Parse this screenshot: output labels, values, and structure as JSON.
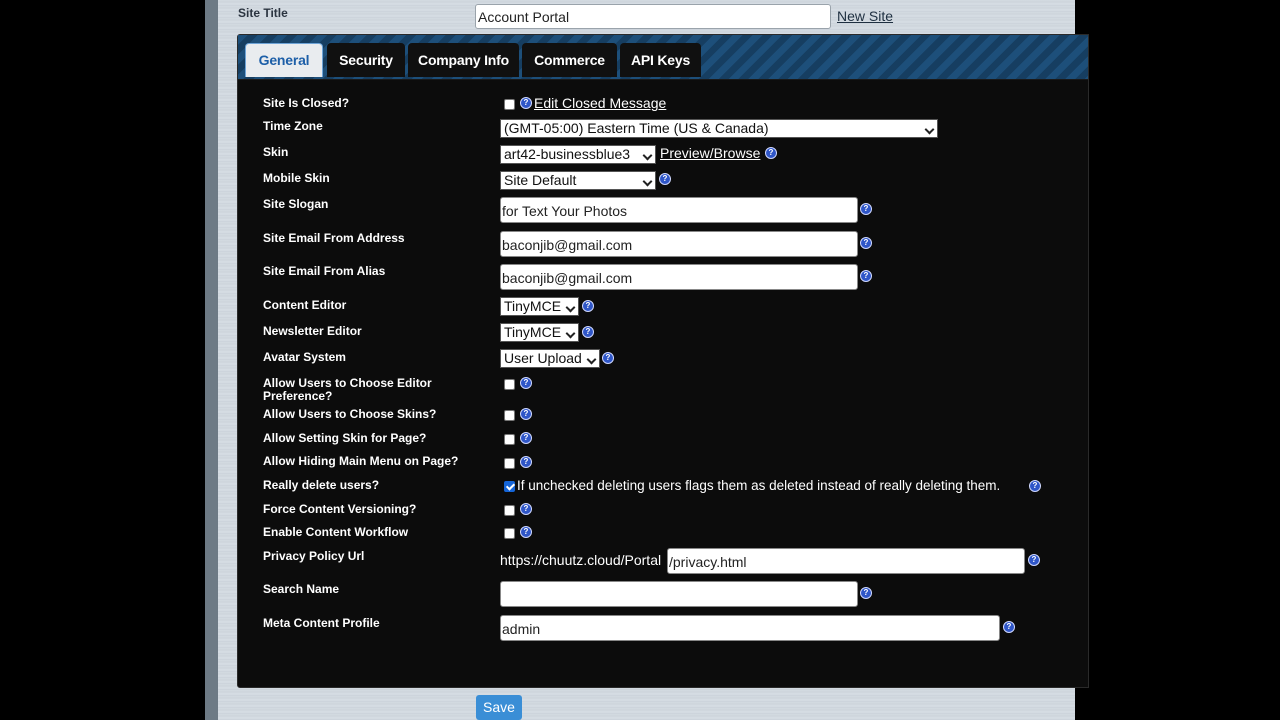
{
  "header": {
    "site_title_label": "Site Title",
    "site_title_value": "Account Portal",
    "new_site_link": "New Site"
  },
  "tabs": [
    {
      "label": "General",
      "active": true
    },
    {
      "label": "Security",
      "active": false
    },
    {
      "label": "Company Info",
      "active": false
    },
    {
      "label": "Commerce",
      "active": false
    },
    {
      "label": "API Keys",
      "active": false
    }
  ],
  "fields": {
    "site_closed": {
      "label": "Site Is Closed?",
      "checked": false,
      "link": "Edit Closed Message"
    },
    "time_zone": {
      "label": "Time Zone",
      "value": "(GMT-05:00) Eastern Time (US & Canada)"
    },
    "skin": {
      "label": "Skin",
      "value": "art42-businessblue3",
      "link": "Preview/Browse"
    },
    "mobile_skin": {
      "label": "Mobile Skin",
      "value": "Site Default"
    },
    "site_slogan": {
      "label": "Site Slogan",
      "value": "for Text Your Photos"
    },
    "email_from": {
      "label": "Site Email From Address",
      "value": "baconjib@gmail.com"
    },
    "email_alias": {
      "label": "Site Email From Alias",
      "value": "baconjib@gmail.com"
    },
    "content_editor": {
      "label": "Content Editor",
      "value": "TinyMCE"
    },
    "newsletter_editor": {
      "label": "Newsletter Editor",
      "value": "TinyMCE"
    },
    "avatar_system": {
      "label": "Avatar System",
      "value": "User Upload"
    },
    "choose_editor": {
      "label_line1": "Allow Users to Choose Editor",
      "label_line2": "Preference?",
      "checked": false
    },
    "choose_skins": {
      "label": "Allow Users to Choose Skins?",
      "checked": false
    },
    "skin_for_page": {
      "label": "Allow Setting Skin for Page?",
      "checked": false
    },
    "hide_main_menu": {
      "label": "Allow Hiding Main Menu on Page?",
      "checked": false
    },
    "really_delete": {
      "label": "Really delete users?",
      "checked": true,
      "note": "If unchecked deleting users flags them as deleted instead of really deleting them."
    },
    "content_versioning": {
      "label": "Force Content Versioning?",
      "checked": false
    },
    "content_workflow": {
      "label": "Enable Content Workflow",
      "checked": false
    },
    "privacy_url": {
      "label": "Privacy Policy Url",
      "prefix": "https://chuutz.cloud/Portal",
      "value": "/privacy.html"
    },
    "search_name": {
      "label": "Search Name",
      "value": ""
    },
    "meta_profile": {
      "label": "Meta Content Profile",
      "value": "admin"
    }
  },
  "save_label": "Save"
}
